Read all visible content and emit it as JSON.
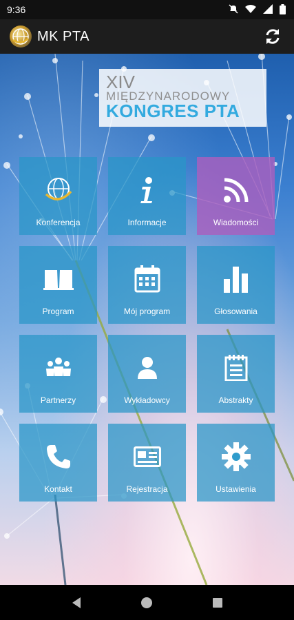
{
  "status_bar": {
    "time": "9:36",
    "icons": [
      "mute-icon",
      "wifi-icon",
      "signal-icon",
      "battery-icon"
    ]
  },
  "app_bar": {
    "title": "MK PTA",
    "logo_icon": "globe-logo-icon",
    "action_icon": "refresh-icon"
  },
  "banner": {
    "line1": "XIV",
    "line2": "MIĘDZYNARODOWY",
    "line3": "KONGRES PTA"
  },
  "tiles": [
    {
      "label": "Konferencja",
      "icon": "globe-icon"
    },
    {
      "label": "Informacje",
      "icon": "info-icon"
    },
    {
      "label": "Wiadomości",
      "icon": "rss-icon"
    },
    {
      "label": "Program",
      "icon": "book-icon"
    },
    {
      "label": "Mój program",
      "icon": "calendar-icon"
    },
    {
      "label": "Głosowania",
      "icon": "bar-chart-icon"
    },
    {
      "label": "Partnerzy",
      "icon": "people-icon"
    },
    {
      "label": "Wykładowcy",
      "icon": "person-icon"
    },
    {
      "label": "Abstrakty",
      "icon": "notepad-icon"
    },
    {
      "label": "Kontakt",
      "icon": "phone-icon"
    },
    {
      "label": "Rejestracja",
      "icon": "id-card-icon"
    },
    {
      "label": "Ustawienia",
      "icon": "gear-icon"
    }
  ],
  "colors": {
    "tile": "#2896c8",
    "tile_highlight": "#aa5fbe",
    "banner_accent": "#33aadf"
  },
  "nav_bar": {
    "icons": [
      "back-icon",
      "home-icon",
      "recents-icon"
    ]
  }
}
